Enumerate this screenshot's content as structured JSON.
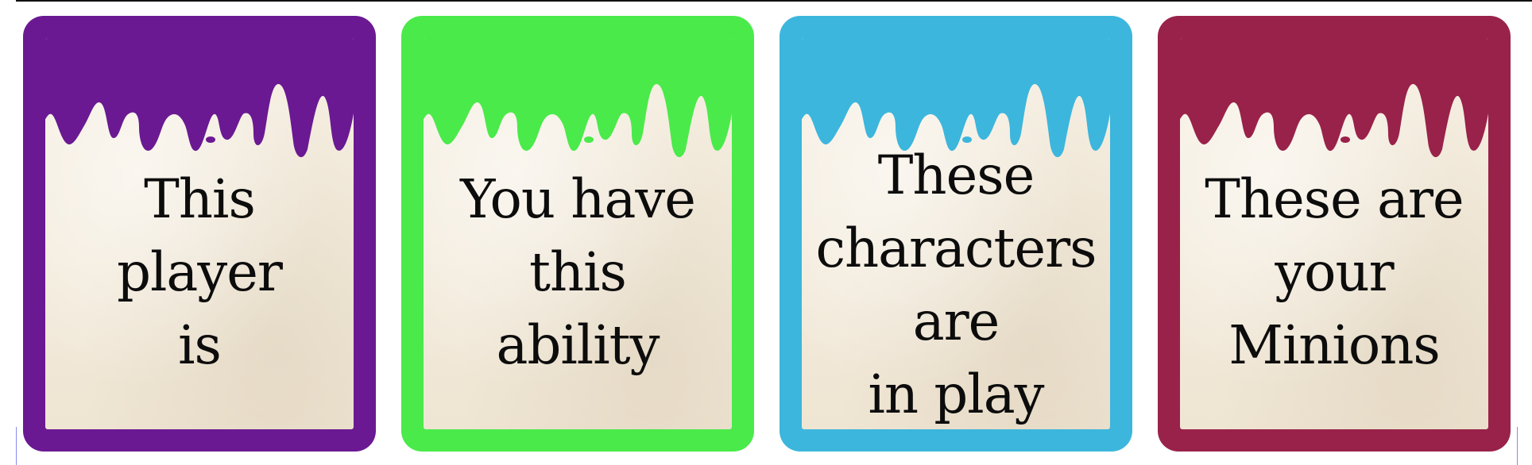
{
  "cards": [
    {
      "lines": [
        "This",
        "player",
        "is"
      ],
      "color": "#6a1992"
    },
    {
      "lines": [
        "You have",
        "this",
        "ability"
      ],
      "color": "#4aea4a"
    },
    {
      "lines": [
        "These",
        "characters",
        "are",
        "in play"
      ],
      "color": "#3cb6dc"
    },
    {
      "lines": [
        "These are",
        "your",
        "Minions"
      ],
      "color": "#99224a"
    }
  ]
}
